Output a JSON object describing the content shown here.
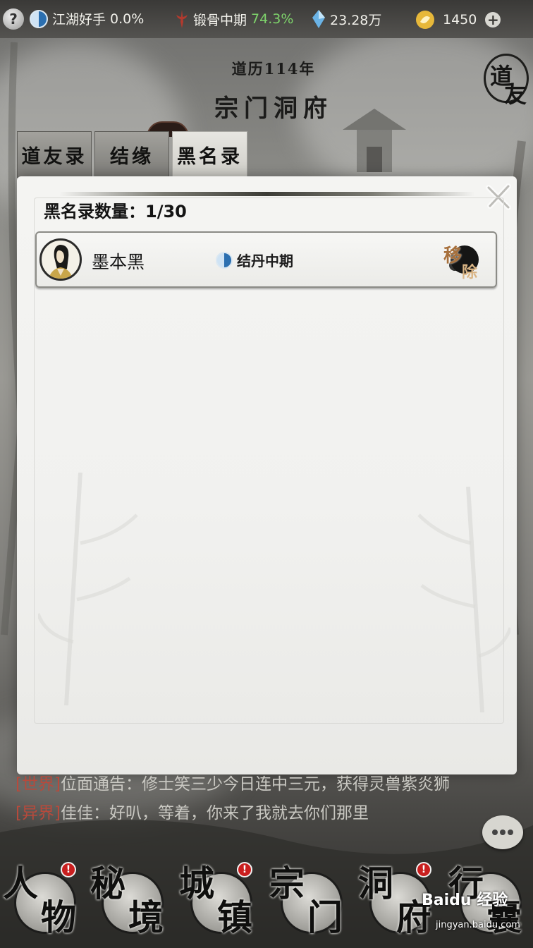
{
  "topbar": {
    "help_label": "?",
    "reputation": {
      "label": "江湖好手",
      "value": "0.0%"
    },
    "cultivation": {
      "label": "锻骨中期",
      "value": "74.3%"
    },
    "spirit_stones": "23.28万",
    "currency": "1450",
    "plus_label": "+"
  },
  "header": {
    "year": "道历114年",
    "title": "宗门洞府",
    "seal_char_1": "道",
    "seal_char_2": "友"
  },
  "tabs": [
    {
      "label": "道友录",
      "active": false
    },
    {
      "label": "结缘",
      "active": false
    },
    {
      "label": "黑名录",
      "active": true
    }
  ],
  "panel": {
    "count_label": "黑名录数量：",
    "count_value": "1/30",
    "entries": [
      {
        "name": "墨本黑",
        "realm": "结丹中期",
        "action_char_1": "移",
        "action_char_2": "除"
      }
    ]
  },
  "chat": [
    {
      "channel": "[世界]",
      "speaker": "位面通告",
      "text": "：修士笑三少今日连中三元，获得灵兽紫炎狮"
    },
    {
      "channel": "[异界]",
      "speaker": "佳佳",
      "text": "：好叭，等着，你来了我就去你们那里"
    }
  ],
  "nav": [
    {
      "c1": "人",
      "c2": "物",
      "badge": "!"
    },
    {
      "c1": "秘",
      "c2": "境",
      "badge": ""
    },
    {
      "c1": "城",
      "c2": "镇",
      "badge": "!"
    },
    {
      "c1": "宗",
      "c2": "门",
      "badge": ""
    },
    {
      "c1": "洞",
      "c2": "府",
      "badge": "!"
    },
    {
      "c1": "行",
      "c2": "囊",
      "badge": ""
    }
  ],
  "watermark": {
    "brand": "Baidu 经验",
    "url": "jingyan.baidu.com"
  },
  "colors": {
    "accent_green": "#7ed36b",
    "badge_red": "#c91f1f",
    "chat_channel": "#b74a3c"
  }
}
